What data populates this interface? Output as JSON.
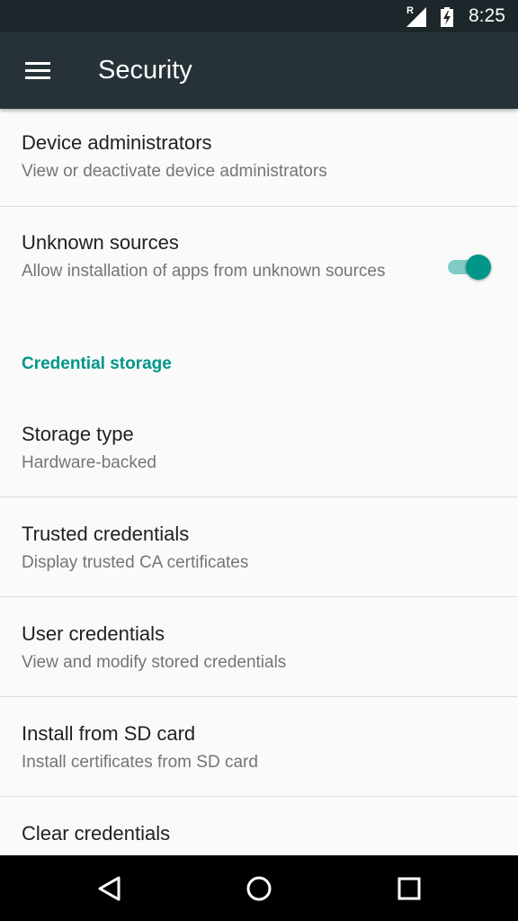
{
  "status_bar": {
    "roaming_indicator": "R",
    "time": "8:25",
    "icons": [
      "signal-icon",
      "battery-charging-icon"
    ]
  },
  "app_bar": {
    "title": "Security",
    "menu_icon": "hamburger-menu-icon"
  },
  "settings": {
    "device_admins": {
      "title": "Device administrators",
      "summary": "View or deactivate device administrators"
    },
    "unknown_sources": {
      "title": "Unknown sources",
      "summary": "Allow installation of apps from unknown sources",
      "enabled": true
    },
    "credential_header": "Credential storage",
    "storage_type": {
      "title": "Storage type",
      "summary": "Hardware-backed"
    },
    "trusted_credentials": {
      "title": "Trusted credentials",
      "summary": "Display trusted CA certificates"
    },
    "user_credentials": {
      "title": "User credentials",
      "summary": "View and modify stored credentials"
    },
    "install_sd": {
      "title": "Install from SD card",
      "summary": "Install certificates from SD card"
    },
    "clear_credentials": {
      "title": "Clear credentials"
    }
  },
  "nav_bar": {
    "icons": [
      "back-icon",
      "home-icon",
      "recents-icon"
    ]
  },
  "colors": {
    "accent": "#009688",
    "app_bar": "#263238",
    "status_bar": "#1c262b",
    "background": "#fafafa"
  }
}
